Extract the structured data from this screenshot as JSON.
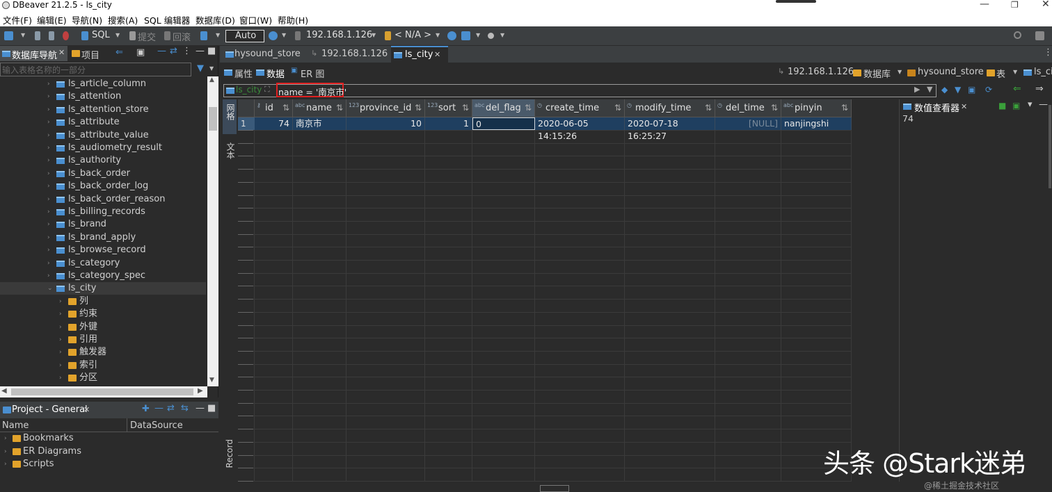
{
  "window": {
    "title": "DBeaver 21.2.5 - ls_city"
  },
  "menu": [
    "文件(F)",
    "编辑(E)",
    "导航(N)",
    "搜索(A)",
    "SQL 编辑器",
    "数据库(D)",
    "窗口(W)",
    "帮助(H)"
  ],
  "toolbar": {
    "sql_label": "SQL",
    "commit_label": "提交",
    "rollback_label": "回滚",
    "tx_mode": "Auto",
    "host": "192.168.1.126",
    "schema": "< N/A >"
  },
  "navigator": {
    "tab_label": "数据库导航",
    "projects_tab_label": "项目",
    "filter_placeholder": "输入表格名称的一部分",
    "tables": [
      "ls_article_column",
      "ls_attention",
      "ls_attention_store",
      "ls_attribute",
      "ls_attribute_value",
      "ls_audiometry_result",
      "ls_authority",
      "ls_back_order",
      "ls_back_order_log",
      "ls_back_order_reason",
      "ls_billing_records",
      "ls_brand",
      "ls_brand_apply",
      "ls_browse_record",
      "ls_category",
      "ls_category_spec",
      "ls_city"
    ],
    "city_children": [
      "列",
      "约束",
      "外键",
      "引用",
      "触发器",
      "索引",
      "分区"
    ]
  },
  "project": {
    "title": "Project - General",
    "col_name": "Name",
    "col_datasource": "DataSource",
    "items": [
      "Bookmarks",
      "ER Diagrams",
      "Scripts"
    ]
  },
  "editor": {
    "tabs": [
      "hysound_store",
      "192.168.1.126",
      "ls_city"
    ],
    "subtabs": [
      "属性",
      "数据",
      "ER 图"
    ],
    "breadcrumb": [
      "192.168.1.126",
      "数据库",
      "hysound_store",
      "表",
      "ls_cit"
    ],
    "filter_table": "ls_city",
    "filter_text": "name = '南京市'",
    "side_tab_grid": "网格",
    "side_tab_text": "文本",
    "side_tab_record": "Record",
    "columns": [
      {
        "name": "id",
        "type": "key"
      },
      {
        "name": "name",
        "type": "abc"
      },
      {
        "name": "province_id",
        "type": "123"
      },
      {
        "name": "sort",
        "type": "123"
      },
      {
        "name": "del_flag",
        "type": "abc"
      },
      {
        "name": "create_time",
        "type": "time"
      },
      {
        "name": "modify_time",
        "type": "time"
      },
      {
        "name": "del_time",
        "type": "time"
      },
      {
        "name": "pinyin",
        "type": "abc"
      }
    ],
    "rows": [
      {
        "num": "1",
        "cells": [
          "74",
          "南京市",
          "10",
          "1",
          "0",
          "2020-06-05 14:15:26",
          "2020-07-18 16:25:27",
          "[NULL]",
          "nanjingshi"
        ]
      }
    ]
  },
  "value_viewer": {
    "title": "数值查看器",
    "value": "74"
  },
  "watermark": "头条 @Stark迷弟",
  "watermark_small": "@稀土掘金技术社区",
  "colors": {
    "selected_cell": "#1f3f60",
    "filter_highlight": "#e02020",
    "folder": "#e2a32b",
    "table_icon": "#4a8fd0"
  }
}
